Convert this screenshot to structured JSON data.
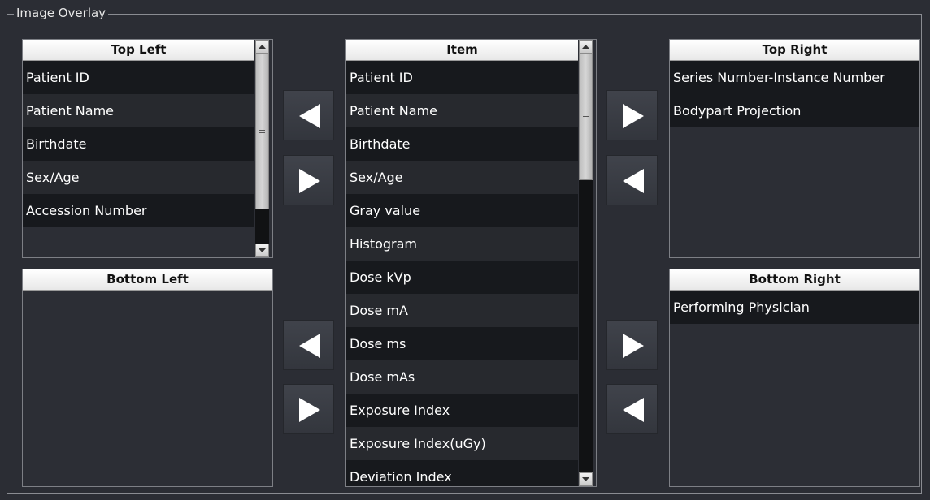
{
  "group": {
    "title": "Image Overlay"
  },
  "top_left": {
    "header": "Top Left",
    "items": [
      "Patient ID",
      "Patient Name",
      "Birthdate",
      "Sex/Age",
      "Accession Number"
    ]
  },
  "bottom_left": {
    "header": "Bottom Left",
    "items": []
  },
  "item_list": {
    "header": "Item",
    "items": [
      "Patient ID",
      "Patient Name",
      "Birthdate",
      "Sex/Age",
      "Gray value",
      "Histogram",
      "Dose kVp",
      "Dose mA",
      "Dose ms",
      "Dose mAs",
      "Exposure Index",
      "Exposure Index(uGy)",
      "Deviation Index"
    ]
  },
  "top_right": {
    "header": "Top Right",
    "items": [
      "Series Number-Instance Number",
      "Bodypart Projection"
    ]
  },
  "bottom_right": {
    "header": "Bottom Right",
    "items": [
      "Performing Physician"
    ]
  },
  "icons": {
    "left_arrow": "arrow-left-icon",
    "right_arrow": "arrow-right-icon",
    "scroll_up": "scroll-up-icon",
    "scroll_down": "scroll-down-icon"
  }
}
